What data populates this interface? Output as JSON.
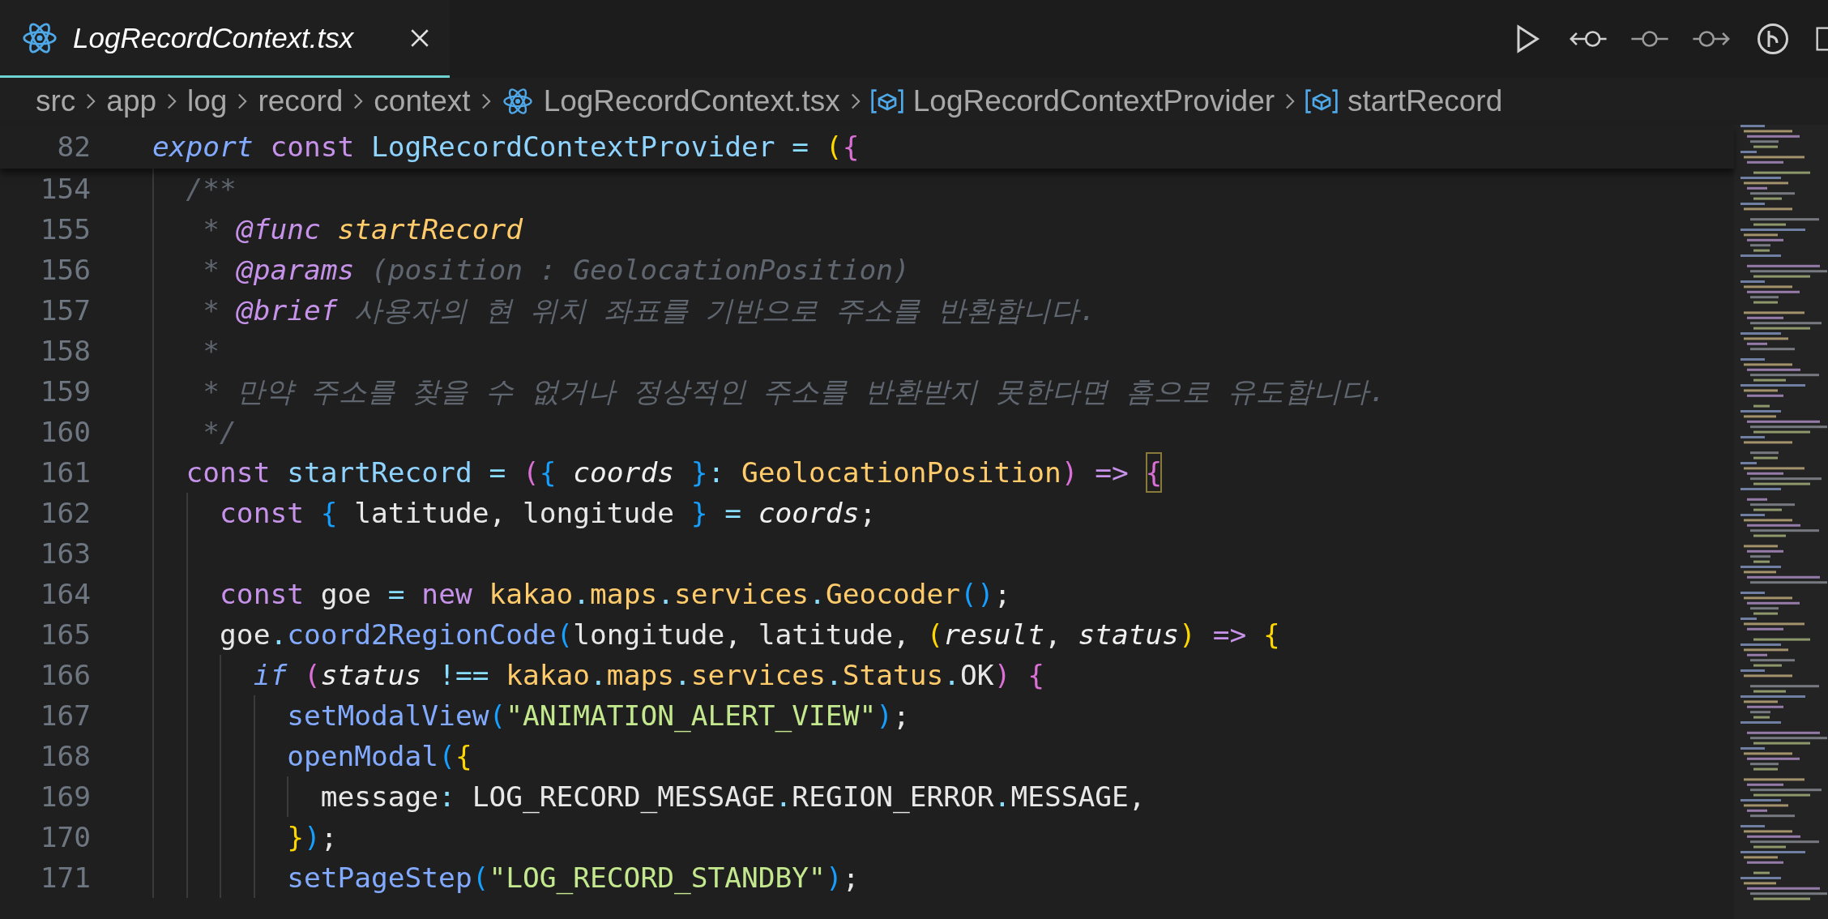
{
  "tab": {
    "title": "LogRecordContext.tsx",
    "selected": true
  },
  "breadcrumbs": [
    {
      "kind": "folder",
      "label": "src"
    },
    {
      "kind": "folder",
      "label": "app"
    },
    {
      "kind": "folder",
      "label": "log"
    },
    {
      "kind": "folder",
      "label": "record"
    },
    {
      "kind": "folder",
      "label": "context"
    },
    {
      "kind": "react",
      "label": "LogRecordContext.tsx"
    },
    {
      "kind": "symbol",
      "label": "LogRecordContextProvider"
    },
    {
      "kind": "symbol",
      "label": "startRecord"
    }
  ],
  "sticky_line": {
    "number": "82",
    "tokens": [
      {
        "text": "export",
        "kind": "kwi"
      },
      {
        "text": " const",
        "kind": "kw"
      },
      {
        "text": " LogRecordContextProvider",
        "kind": "id"
      },
      {
        "text": " =",
        "kind": "punct"
      },
      {
        "text": " (",
        "kind": "b1"
      },
      {
        "text": "{",
        "kind": "b2"
      }
    ]
  },
  "lines": [
    {
      "number": "154",
      "tokens": [
        {
          "text": "  /**",
          "kind": "comment"
        }
      ]
    },
    {
      "number": "155",
      "tokens": [
        {
          "text": "   * ",
          "kind": "comment"
        },
        {
          "text": "@func",
          "kind": "ctag"
        },
        {
          "text": " startRecord",
          "kind": "cname"
        }
      ]
    },
    {
      "number": "156",
      "tokens": [
        {
          "text": "   * ",
          "kind": "comment"
        },
        {
          "text": "@params",
          "kind": "ctag"
        },
        {
          "text": " (position : GeolocationPosition)",
          "kind": "comment"
        }
      ]
    },
    {
      "number": "157",
      "tokens": [
        {
          "text": "   * ",
          "kind": "comment"
        },
        {
          "text": "@brief",
          "kind": "ctag"
        },
        {
          "text": " 사용자의 현 위치 좌표를 기반으로 주소를 반환합니다.",
          "kind": "comment"
        }
      ]
    },
    {
      "number": "158",
      "tokens": [
        {
          "text": "   *",
          "kind": "comment"
        }
      ]
    },
    {
      "number": "159",
      "tokens": [
        {
          "text": "   * 만약 주소를 찾을 수 없거나 정상적인 주소를 반환받지 못한다면 홈으로 유도합니다.",
          "kind": "comment"
        }
      ]
    },
    {
      "number": "160",
      "tokens": [
        {
          "text": "   */",
          "kind": "comment"
        }
      ]
    },
    {
      "number": "161",
      "tokens": [
        {
          "text": "  const",
          "kind": "kw"
        },
        {
          "text": " startRecord",
          "kind": "id"
        },
        {
          "text": " =",
          "kind": "punct"
        },
        {
          "text": " (",
          "kind": "b2"
        },
        {
          "text": "{",
          "kind": "b3"
        },
        {
          "text": " coords",
          "kind": "param"
        },
        {
          "text": " }",
          "kind": "b3"
        },
        {
          "text": ":",
          "kind": "punct"
        },
        {
          "text": " GeolocationPosition",
          "kind": "type"
        },
        {
          "text": ")",
          "kind": "b2"
        },
        {
          "text": " => ",
          "kind": "kw"
        },
        {
          "text": "{",
          "kind": "b2",
          "bracket_match": true
        }
      ]
    },
    {
      "number": "162",
      "tokens": [
        {
          "text": "    const",
          "kind": "kw"
        },
        {
          "text": " {",
          "kind": "b3"
        },
        {
          "text": " latitude, longitude",
          "kind": "plain"
        },
        {
          "text": " }",
          "kind": "b3"
        },
        {
          "text": " =",
          "kind": "punct"
        },
        {
          "text": " coords",
          "kind": "param"
        },
        {
          "text": ";",
          "kind": "plain"
        }
      ]
    },
    {
      "number": "163"
    },
    {
      "number": "164",
      "tokens": [
        {
          "text": "    const",
          "kind": "kw"
        },
        {
          "text": " goe",
          "kind": "plain"
        },
        {
          "text": " =",
          "kind": "punct"
        },
        {
          "text": " new",
          "kind": "kw"
        },
        {
          "text": " kakao",
          "kind": "type"
        },
        {
          "text": ".",
          "kind": "punct"
        },
        {
          "text": "maps",
          "kind": "type"
        },
        {
          "text": ".",
          "kind": "punct"
        },
        {
          "text": "services",
          "kind": "type"
        },
        {
          "text": ".",
          "kind": "punct"
        },
        {
          "text": "Geocoder",
          "kind": "type"
        },
        {
          "text": "(",
          "kind": "b3"
        },
        {
          "text": ")",
          "kind": "b3"
        },
        {
          "text": ";",
          "kind": "plain"
        }
      ]
    },
    {
      "number": "165",
      "tokens": [
        {
          "text": "    goe",
          "kind": "plain"
        },
        {
          "text": ".",
          "kind": "punct"
        },
        {
          "text": "coord2RegionCode",
          "kind": "fn"
        },
        {
          "text": "(",
          "kind": "b3"
        },
        {
          "text": "longitude, latitude, ",
          "kind": "plain"
        },
        {
          "text": "(",
          "kind": "b1"
        },
        {
          "text": "result",
          "kind": "param"
        },
        {
          "text": ", ",
          "kind": "plain"
        },
        {
          "text": "status",
          "kind": "param"
        },
        {
          "text": ")",
          "kind": "b1"
        },
        {
          "text": " => ",
          "kind": "kw"
        },
        {
          "text": "{",
          "kind": "b1"
        }
      ]
    },
    {
      "number": "166",
      "tokens": [
        {
          "text": "      if",
          "kind": "kwi"
        },
        {
          "text": " (",
          "kind": "b2"
        },
        {
          "text": "status",
          "kind": "param"
        },
        {
          "text": " !==",
          "kind": "punct"
        },
        {
          "text": " kakao",
          "kind": "type"
        },
        {
          "text": ".",
          "kind": "punct"
        },
        {
          "text": "maps",
          "kind": "type"
        },
        {
          "text": ".",
          "kind": "punct"
        },
        {
          "text": "services",
          "kind": "type"
        },
        {
          "text": ".",
          "kind": "punct"
        },
        {
          "text": "Status",
          "kind": "type"
        },
        {
          "text": ".",
          "kind": "punct"
        },
        {
          "text": "OK",
          "kind": "plain"
        },
        {
          "text": ")",
          "kind": "b2"
        },
        {
          "text": " {",
          "kind": "b2"
        }
      ]
    },
    {
      "number": "167",
      "tokens": [
        {
          "text": "        setModalView",
          "kind": "fn"
        },
        {
          "text": "(",
          "kind": "b3"
        },
        {
          "text": "\"ANIMATION_ALERT_VIEW\"",
          "kind": "str"
        },
        {
          "text": ")",
          "kind": "b3"
        },
        {
          "text": ";",
          "kind": "plain"
        }
      ]
    },
    {
      "number": "168",
      "tokens": [
        {
          "text": "        openModal",
          "kind": "fn"
        },
        {
          "text": "(",
          "kind": "b3"
        },
        {
          "text": "{",
          "kind": "b1"
        }
      ]
    },
    {
      "number": "169",
      "tokens": [
        {
          "text": "          message",
          "kind": "plain"
        },
        {
          "text": ":",
          "kind": "punct"
        },
        {
          "text": " LOG_RECORD_MESSAGE",
          "kind": "plain"
        },
        {
          "text": ".",
          "kind": "punct"
        },
        {
          "text": "REGION_ERROR",
          "kind": "plain"
        },
        {
          "text": ".",
          "kind": "punct"
        },
        {
          "text": "MESSAGE",
          "kind": "plain"
        },
        {
          "text": ",",
          "kind": "plain"
        }
      ]
    },
    {
      "number": "170",
      "tokens": [
        {
          "text": "        }",
          "kind": "b1"
        },
        {
          "text": ")",
          "kind": "b3"
        },
        {
          "text": ";",
          "kind": "plain"
        }
      ]
    },
    {
      "number": "171",
      "tokens": [
        {
          "text": "        setPageStep",
          "kind": "fn"
        },
        {
          "text": "(",
          "kind": "b3"
        },
        {
          "text": "\"LOG_RECORD_STANDBY\"",
          "kind": "str"
        },
        {
          "text": ")",
          "kind": "b3"
        },
        {
          "text": ";",
          "kind": "plain"
        }
      ]
    }
  ]
}
